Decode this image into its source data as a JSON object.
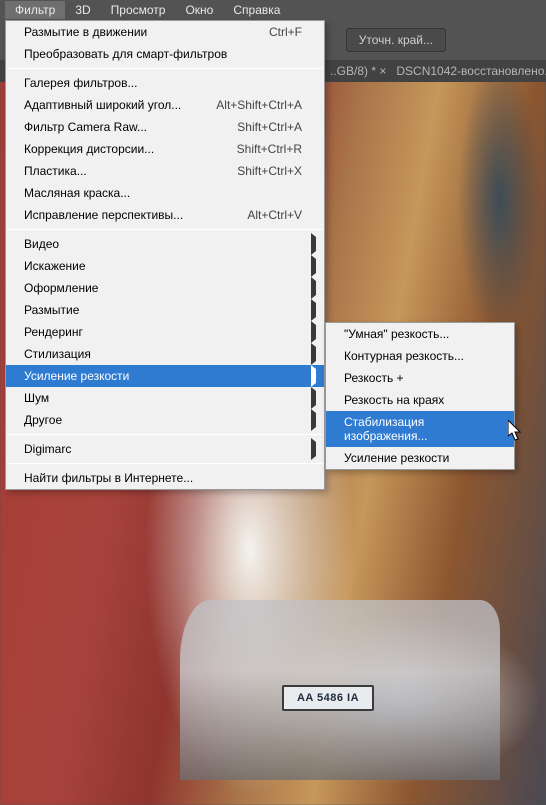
{
  "menubar": {
    "items": [
      "Фильтр",
      "3D",
      "Просмотр",
      "Окно",
      "Справка"
    ],
    "active_index": 0
  },
  "toolbar": {
    "refine_btn": "Уточн. край..."
  },
  "tabbar": {
    "tab_left": "..GB/8) * ×",
    "tab_right": "DSCN1042-восстановлено.."
  },
  "menu": {
    "group1": [
      {
        "label": "Размытие в движении",
        "shortcut": "Ctrl+F"
      },
      {
        "label": "Преобразовать для смарт-фильтров"
      }
    ],
    "group2": [
      {
        "label": "Галерея фильтров..."
      },
      {
        "label": "Адаптивный широкий угол...",
        "shortcut": "Alt+Shift+Ctrl+A"
      },
      {
        "label": "Фильтр Camera Raw...",
        "shortcut": "Shift+Ctrl+A"
      },
      {
        "label": "Коррекция дисторсии...",
        "shortcut": "Shift+Ctrl+R"
      },
      {
        "label": "Пластика...",
        "shortcut": "Shift+Ctrl+X"
      },
      {
        "label": "Масляная краска..."
      },
      {
        "label": "Исправление перспективы...",
        "shortcut": "Alt+Ctrl+V"
      }
    ],
    "group3": [
      {
        "label": "Видео",
        "sub": true
      },
      {
        "label": "Искажение",
        "sub": true
      },
      {
        "label": "Оформление",
        "sub": true
      },
      {
        "label": "Размытие",
        "sub": true
      },
      {
        "label": "Рендеринг",
        "sub": true
      },
      {
        "label": "Стилизация",
        "sub": true
      },
      {
        "label": "Усиление резкости",
        "sub": true,
        "highlight": true
      },
      {
        "label": "Шум",
        "sub": true
      },
      {
        "label": "Другое",
        "sub": true
      }
    ],
    "group4": [
      {
        "label": "Digimarc",
        "sub": true
      }
    ],
    "group5": [
      {
        "label": "Найти фильтры в Интернете..."
      }
    ]
  },
  "submenu": {
    "group1": [
      {
        "label": "\"Умная\" резкость..."
      },
      {
        "label": "Контурная резкость..."
      },
      {
        "label": "Резкость +"
      },
      {
        "label": "Резкость на краях"
      },
      {
        "label": "Стабилизация изображения...",
        "highlight": true
      },
      {
        "label": "Усиление резкости"
      }
    ]
  },
  "plate_text": "AA 5486 IA"
}
